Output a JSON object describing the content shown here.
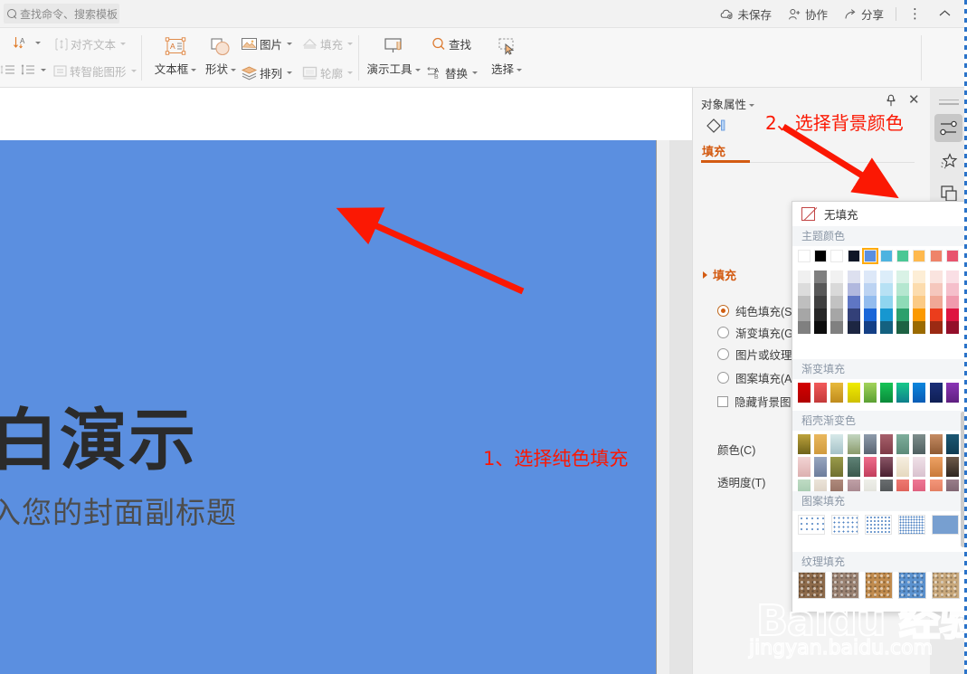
{
  "topbar": {
    "search_placeholder": "查找命令、搜索模板",
    "unsaved_label": "未保存",
    "collab_label": "协作",
    "share_label": "分享",
    "more_label": "⋮",
    "collapse_label": "⌃"
  },
  "ribbon": {
    "groups": [
      {
        "name": "text-group",
        "items": [
          {
            "label": "对齐文本",
            "dim": true,
            "caret": true
          },
          {
            "label": "转智能图形",
            "dim": true,
            "caret": true
          }
        ]
      },
      {
        "name": "insert-group",
        "items": [
          {
            "label": "文本框",
            "dim": false,
            "caret": true
          },
          {
            "label": "形状",
            "dim": false,
            "caret": true
          },
          {
            "label": "图片",
            "dim": false,
            "caret": true
          },
          {
            "label": "填充",
            "dim": true,
            "caret": true
          },
          {
            "label": "排列",
            "dim": false,
            "caret": true
          },
          {
            "label": "轮廓",
            "dim": true,
            "caret": true
          }
        ]
      },
      {
        "name": "tools-group",
        "items": [
          {
            "label": "演示工具",
            "dim": false,
            "caret": true
          },
          {
            "label": "查找",
            "dim": false,
            "caret": false
          },
          {
            "label": "替换",
            "dim": false,
            "caret": true
          },
          {
            "label": "选择",
            "dim": false,
            "caret": true
          }
        ]
      }
    ]
  },
  "slide": {
    "background_color": "#5b8fe0",
    "title": "白演示",
    "subtitle": "入您的封面副标题"
  },
  "annotations": {
    "step1": "1、选择纯色填充",
    "step2": "2、选择背景颜色",
    "color": "#fb1803"
  },
  "panel": {
    "title": "对象属性",
    "pin_icon": "pin-icon",
    "close_icon": "close-icon",
    "tab_label": "填充",
    "section_label": "填充",
    "fill_preview_color": "#5b8fe0",
    "options": [
      {
        "label": "纯色填充(S)",
        "type": "radio",
        "selected": true
      },
      {
        "label": "渐变填充(G)",
        "type": "radio",
        "selected": false
      },
      {
        "label": "图片或纹理填充(P)",
        "type": "radio",
        "selected": false
      },
      {
        "label": "图案填充(A)",
        "type": "radio",
        "selected": false
      },
      {
        "label": "隐藏背景图形(H)",
        "type": "checkbox",
        "selected": false
      }
    ],
    "color_label": "颜色(C)",
    "transparency_label": "透明度(T)"
  },
  "dropdown": {
    "no_fill_label": "无填充",
    "theme_colors_label": "主题颜色",
    "gradient_fill_label": "渐变填充",
    "docer_gradient_label": "稻壳渐变色",
    "pattern_fill_label": "图案填充",
    "texture_fill_label": "纹理填充",
    "theme_top": [
      "#ffffff",
      "#000000",
      "#ffffff",
      "#0f1626",
      "#5b8fe0",
      "#4eb3e0",
      "#4ac795",
      "#ffb94e",
      "#ef8369",
      "#e8546e"
    ],
    "theme_selected_index": 4,
    "theme_rows": [
      [
        "#f0f0f0",
        "#808080",
        "#f1f1f1",
        "#dde0ef",
        "#dde8f8",
        "#dcedf9",
        "#d9f2e6",
        "#fdeed6",
        "#fae4df",
        "#fadfe5"
      ],
      [
        "#dcdcdc",
        "#595959",
        "#d9d9d9",
        "#b1b8de",
        "#bcd3f2",
        "#b7e1f4",
        "#b5e7d0",
        "#fcdcae",
        "#f5c7bd",
        "#f5bfcb"
      ],
      [
        "#bfbfbf",
        "#404040",
        "#c2c2c2",
        "#5f76c4",
        "#93bcee",
        "#8fd5ef",
        "#8edbb7",
        "#fbca85",
        "#f0a896",
        "#f09aad"
      ],
      [
        "#a6a6a6",
        "#262626",
        "#a6a6a6",
        "#334078",
        "#1a66d8",
        "#1797d0",
        "#2da06c",
        "#fb9900",
        "#eb3d1c",
        "#de1440"
      ],
      [
        "#808080",
        "#0d0d0d",
        "#808080",
        "#1d2642",
        "#143f85",
        "#146180",
        "#1d6243",
        "#9b6a00",
        "#9b2a13",
        "#930f2a"
      ]
    ],
    "gradients": [
      [
        "#d40000",
        "#b00000"
      ],
      [
        "#f25a5a",
        "#c43a3a"
      ],
      [
        "#e8b93b",
        "#c08c1d"
      ],
      [
        "#f0ec00",
        "#cfc000"
      ],
      [
        "#a3d35a",
        "#5ba033"
      ],
      [
        "#17c456",
        "#0a8a3a"
      ],
      [
        "#18c98a",
        "#0e7f8c"
      ],
      [
        "#0b86dd",
        "#0a5cb5"
      ],
      [
        "#1b2f78",
        "#0f1f55"
      ],
      [
        "#8a36b5",
        "#5f2080"
      ]
    ],
    "docer_gradients": [
      [
        [
          "#bda23c",
          "#6e6219"
        ],
        [
          "#eab85e",
          "#d09a3d"
        ],
        [
          "#d7e9e9",
          "#a5c2c8"
        ],
        [
          "#c3d6c1",
          "#8a9a6a"
        ],
        [
          "#8e9bab",
          "#5a6472"
        ],
        [
          "#a8616c",
          "#7d3a46"
        ],
        [
          "#7fae9c",
          "#5b8a78"
        ],
        [
          "#7e8e8c",
          "#4f5f60"
        ],
        [
          "#c58b63",
          "#8e5a33"
        ],
        [
          "#1c5873",
          "#0f3b52"
        ]
      ],
      [
        [
          "#f3d4d4",
          "#dcb0b0"
        ],
        [
          "#98a6c0",
          "#6d7d9c"
        ],
        [
          "#9a9b4a",
          "#6f7030"
        ],
        [
          "#5f8276",
          "#3b5a4e"
        ],
        [
          "#ef6d8c",
          "#c23f5d"
        ],
        [
          "#8a5566",
          "#4a2030"
        ],
        [
          "#f6efe0",
          "#e6d9bf"
        ],
        [
          "#f0e1e8",
          "#d9c2cf"
        ],
        [
          "#eda164",
          "#c97a3a"
        ],
        [
          "#6f5a4a",
          "#2e2620"
        ]
      ],
      [
        [
          "#bfdcc4",
          "#9cc4a6"
        ],
        [
          "#ece4d9",
          "#d6cabc"
        ],
        [
          "#b08a7c",
          "#8a6659"
        ],
        [
          "#c0a0a6",
          "#9a7a82"
        ],
        [
          "#eeefe9",
          "#dcdcd4"
        ],
        [
          "#6a6e70",
          "#44484a"
        ],
        [
          "#ef7a72",
          "#d4544c"
        ],
        [
          "#ef7896",
          "#d4526f"
        ],
        [
          "#f4977a",
          "#d86f52"
        ],
        [
          "#9a7e8a",
          "#6f5763"
        ]
      ]
    ],
    "patterns": [
      {
        "density": 1
      },
      {
        "density": 2
      },
      {
        "density": 3
      },
      {
        "density": 4
      },
      {
        "density": 5
      }
    ],
    "textures": [
      "#8d6a4a",
      "#9a8272",
      "#c08b4e",
      "#5b92cf",
      "#c8a87c"
    ]
  },
  "rail": {
    "items": [
      {
        "name": "properties-icon",
        "selected": true
      },
      {
        "name": "star-effects-icon",
        "selected": false
      },
      {
        "name": "duplicate-icon",
        "selected": false
      }
    ]
  },
  "watermark": {
    "brand": "Baidu 经验",
    "url": "jingyan.baidu.com"
  }
}
